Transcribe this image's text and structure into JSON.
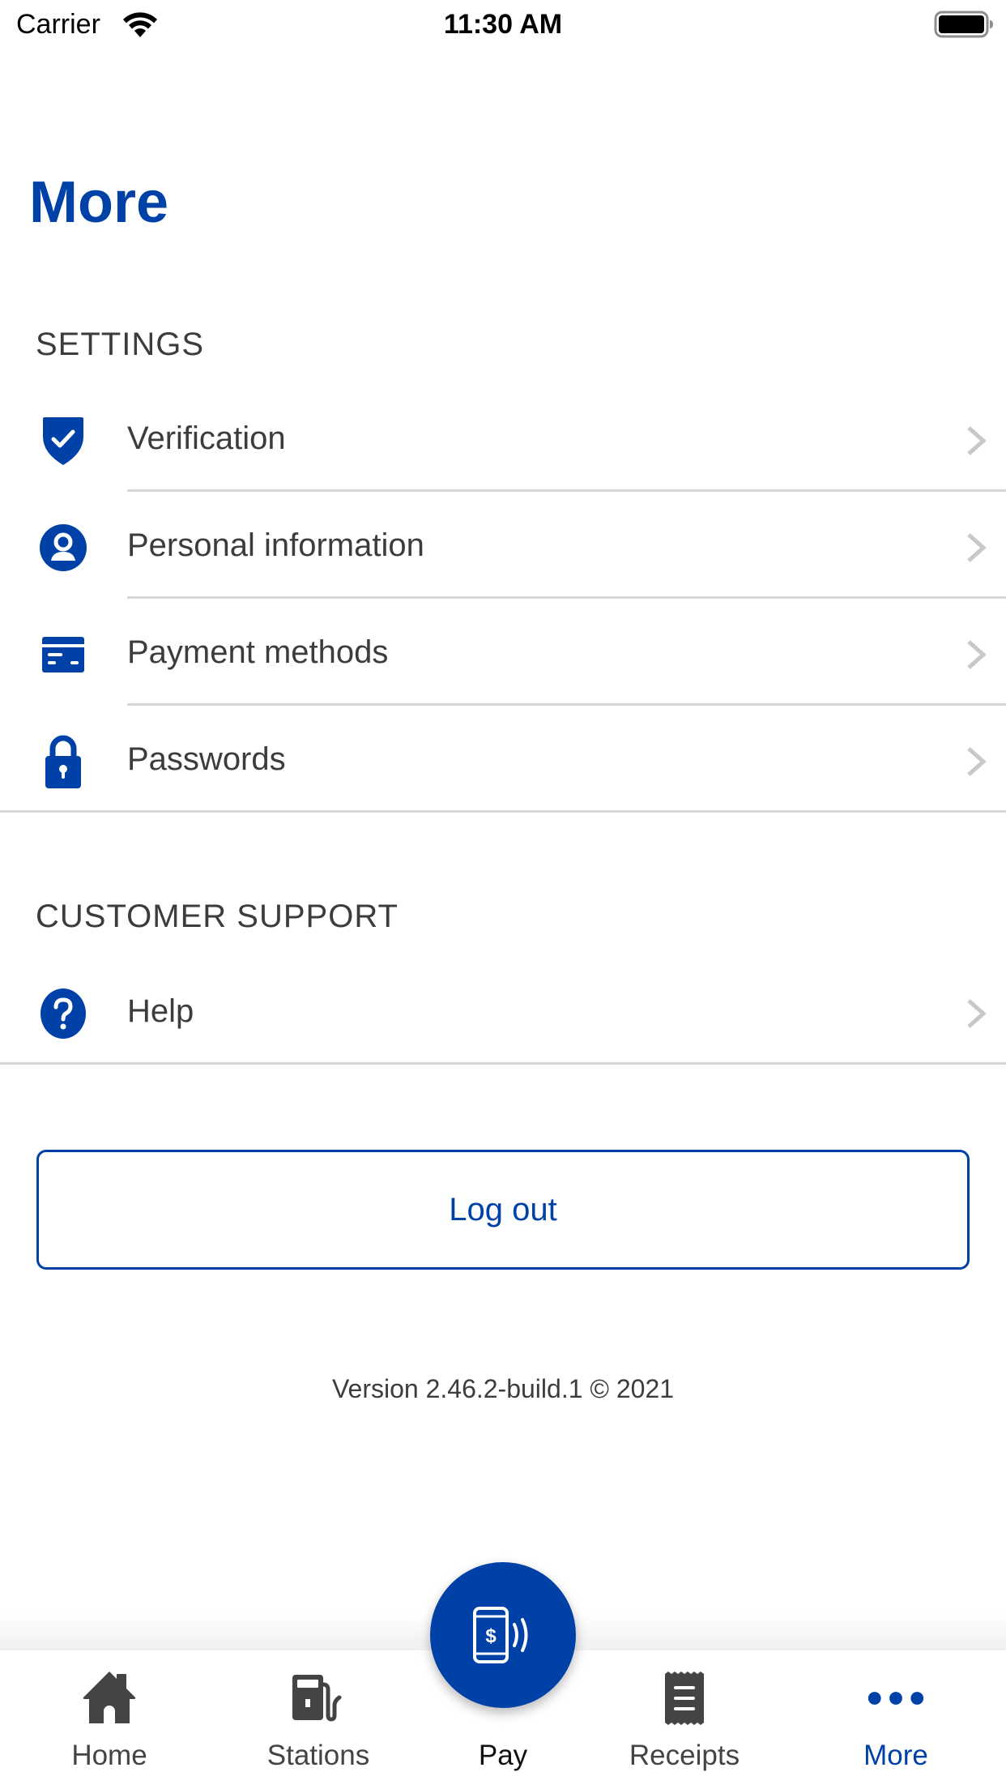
{
  "status_bar": {
    "carrier": "Carrier",
    "time": "11:30 AM",
    "wifi_icon": "wifi-icon",
    "battery_icon": "battery-full-icon"
  },
  "page": {
    "title": "More"
  },
  "sections": {
    "settings": {
      "header": "SETTINGS",
      "items": [
        {
          "label": "Verification",
          "icon": "shield-check-icon"
        },
        {
          "label": "Personal information",
          "icon": "person-circle-icon"
        },
        {
          "label": "Payment methods",
          "icon": "credit-card-icon"
        },
        {
          "label": "Passwords",
          "icon": "lock-icon"
        }
      ]
    },
    "support": {
      "header": "CUSTOMER SUPPORT",
      "items": [
        {
          "label": "Help",
          "icon": "question-circle-icon"
        }
      ]
    }
  },
  "logout": {
    "label": "Log out"
  },
  "footer": {
    "version": "Version 2.46.2-build.1 © 2021"
  },
  "tabbar": {
    "active": "More",
    "tabs": [
      {
        "label": "Home",
        "icon": "home-icon"
      },
      {
        "label": "Stations",
        "icon": "fuel-pump-icon"
      },
      {
        "label": "Pay",
        "icon": "phone-pay-icon"
      },
      {
        "label": "Receipts",
        "icon": "receipt-icon"
      },
      {
        "label": "More",
        "icon": "more-dots-icon"
      }
    ]
  },
  "colors": {
    "brand": "#0041A8",
    "text": "#3C3C3C",
    "divider": "#D6D6D6",
    "chevron": "#C7C7CC",
    "tab_inactive": "#444444"
  }
}
